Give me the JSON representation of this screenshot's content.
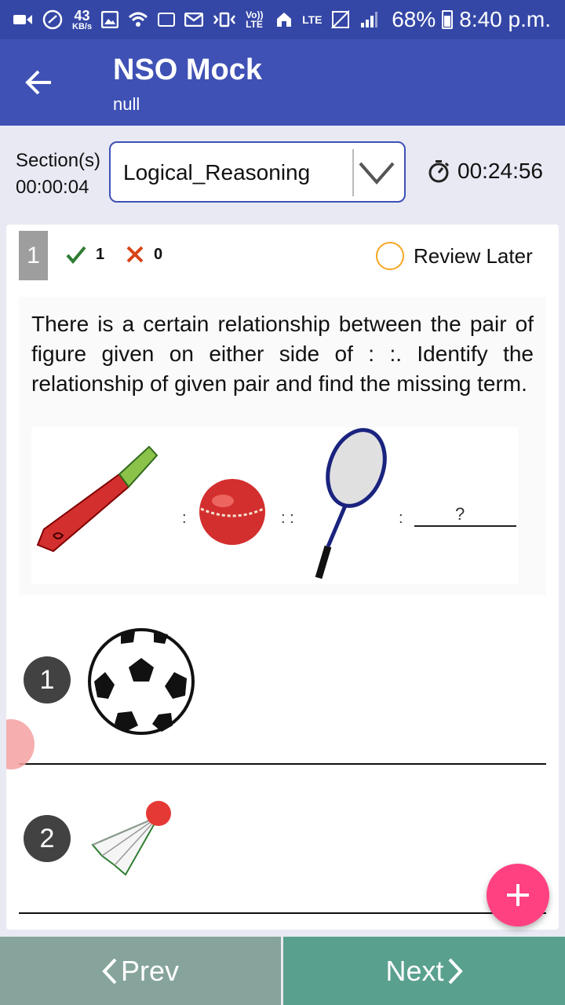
{
  "status_bar": {
    "speed_value": "43",
    "speed_unit": "KB/s",
    "volte": "Vo)) LTE",
    "lte": "LTE",
    "battery": "68%",
    "time": "8:40 p.m."
  },
  "app_bar": {
    "title": "NSO Mock",
    "subtitle": "null"
  },
  "section": {
    "label": "Section(s)",
    "elapsed": "00:00:04",
    "selected": "Logical_Reasoning",
    "timer": "00:24:56"
  },
  "question": {
    "number": "1",
    "correct_marks": "1",
    "wrong_marks": "0",
    "review_label": "Review Later",
    "text": "There is a certain relationship between the pair of figure given on either side of : :. Identify the relationship of given pair and find the missing term.",
    "figure": {
      "sep1": ":",
      "sep2": ": :",
      "sep3": ":",
      "missing": "?"
    }
  },
  "options": [
    {
      "number": "1",
      "icon": "football-icon"
    },
    {
      "number": "2",
      "icon": "shuttlecock-icon"
    }
  ],
  "nav": {
    "prev": "Prev",
    "next": "Next"
  },
  "colors": {
    "primary": "#3f51b5",
    "status_bar": "#3447a6",
    "accent": "#ff4081",
    "prev": "#86a49b",
    "next": "#5aa08f"
  }
}
